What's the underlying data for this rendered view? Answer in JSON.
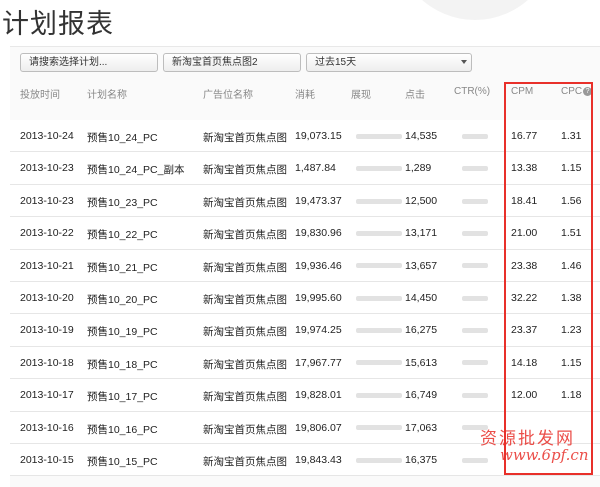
{
  "page": {
    "title": "计划报表"
  },
  "filters": {
    "plan_select": "请搜索选择计划...",
    "ad_slot": "新淘宝首页焦点图2",
    "date_range": "过去15天"
  },
  "table": {
    "columns": [
      "投放时间",
      "计划名称",
      "广告位名称",
      "消耗",
      "展现",
      "点击",
      "CTR(%)",
      "CPM",
      "CPC"
    ],
    "help_glyph": "?",
    "rows": [
      {
        "date": "2013-10-24",
        "plan": "预售10_24_PC",
        "slot": "新淘宝首页焦点图",
        "cost": "19,073.15",
        "clicks": "14,535",
        "cpm": "16.77",
        "cpc": "1.31"
      },
      {
        "date": "2013-10-23",
        "plan": "预售10_24_PC_副本",
        "slot": "新淘宝首页焦点图",
        "cost": "1,487.84",
        "clicks": "1,289",
        "cpm": "13.38",
        "cpc": "1.15"
      },
      {
        "date": "2013-10-23",
        "plan": "预售10_23_PC",
        "slot": "新淘宝首页焦点图",
        "cost": "19,473.37",
        "clicks": "12,500",
        "cpm": "18.41",
        "cpc": "1.56"
      },
      {
        "date": "2013-10-22",
        "plan": "预售10_22_PC",
        "slot": "新淘宝首页焦点图",
        "cost": "19,830.96",
        "clicks": "13,171",
        "cpm": "21.00",
        "cpc": "1.51"
      },
      {
        "date": "2013-10-21",
        "plan": "预售10_21_PC",
        "slot": "新淘宝首页焦点图",
        "cost": "19,936.46",
        "clicks": "13,657",
        "cpm": "23.38",
        "cpc": "1.46"
      },
      {
        "date": "2013-10-20",
        "plan": "预售10_20_PC",
        "slot": "新淘宝首页焦点图",
        "cost": "19,995.60",
        "clicks": "14,450",
        "cpm": "32.22",
        "cpc": "1.38"
      },
      {
        "date": "2013-10-19",
        "plan": "预售10_19_PC",
        "slot": "新淘宝首页焦点图",
        "cost": "19,974.25",
        "clicks": "16,275",
        "cpm": "23.37",
        "cpc": "1.23"
      },
      {
        "date": "2013-10-18",
        "plan": "预售10_18_PC",
        "slot": "新淘宝首页焦点图",
        "cost": "17,967.77",
        "clicks": "15,613",
        "cpm": "14.18",
        "cpc": "1.15"
      },
      {
        "date": "2013-10-17",
        "plan": "预售10_17_PC",
        "slot": "新淘宝首页焦点图",
        "cost": "19,828.01",
        "clicks": "16,749",
        "cpm": "12.00",
        "cpc": "1.18"
      },
      {
        "date": "2013-10-16",
        "plan": "预售10_16_PC",
        "slot": "新淘宝首页焦点图",
        "cost": "19,806.07",
        "clicks": "17,063",
        "cpm": "",
        "cpc": ""
      },
      {
        "date": "2013-10-15",
        "plan": "预售10_15_PC",
        "slot": "新淘宝首页焦点图",
        "cost": "19,843.43",
        "clicks": "16,375",
        "cpm": "",
        "cpc": ""
      }
    ]
  },
  "watermark": {
    "text": "资源批发网",
    "url": "www.6pf.cn"
  },
  "colors": {
    "highlight": "#e8302a",
    "header_bg": "#fafafa"
  }
}
